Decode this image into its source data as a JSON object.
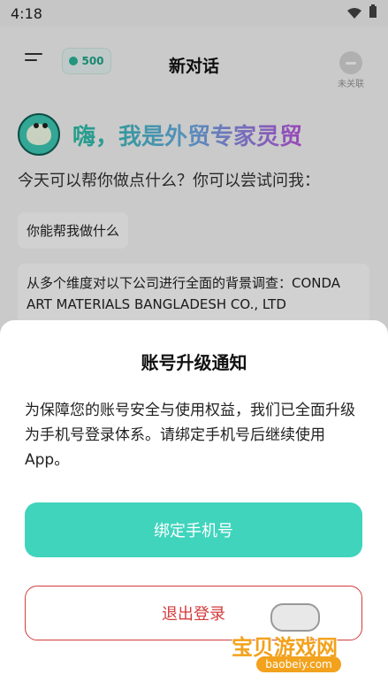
{
  "status_bar": {
    "time": "4:18"
  },
  "header": {
    "title": "新对话",
    "coin_count": "500",
    "follow_label": "未关联"
  },
  "hero": {
    "title": "嗨，我是外贸专家灵贸",
    "subtitle": "今天可以帮你做点什么？你可以尝试问我："
  },
  "suggestions": [
    {
      "text": "你能帮我做什么"
    },
    {
      "text": "从多个维度对以下公司进行全面的背景调查：CONDA ART MATERIALS BANGLADESH CO., LTD"
    }
  ],
  "dialog": {
    "title": "账号升级通知",
    "body": "为保障您的账号安全与使用权益，我们已全面升级为手机号登录体系。请绑定手机号后继续使用App。",
    "primary_button": "绑定手机号",
    "secondary_button": "退出登录"
  },
  "watermark": {
    "text": "宝贝游戏网",
    "url": "baobeiy.com"
  },
  "colors": {
    "accent": "#40d4bd",
    "danger": "#d33c3c",
    "watermark": "#f2a21d"
  }
}
